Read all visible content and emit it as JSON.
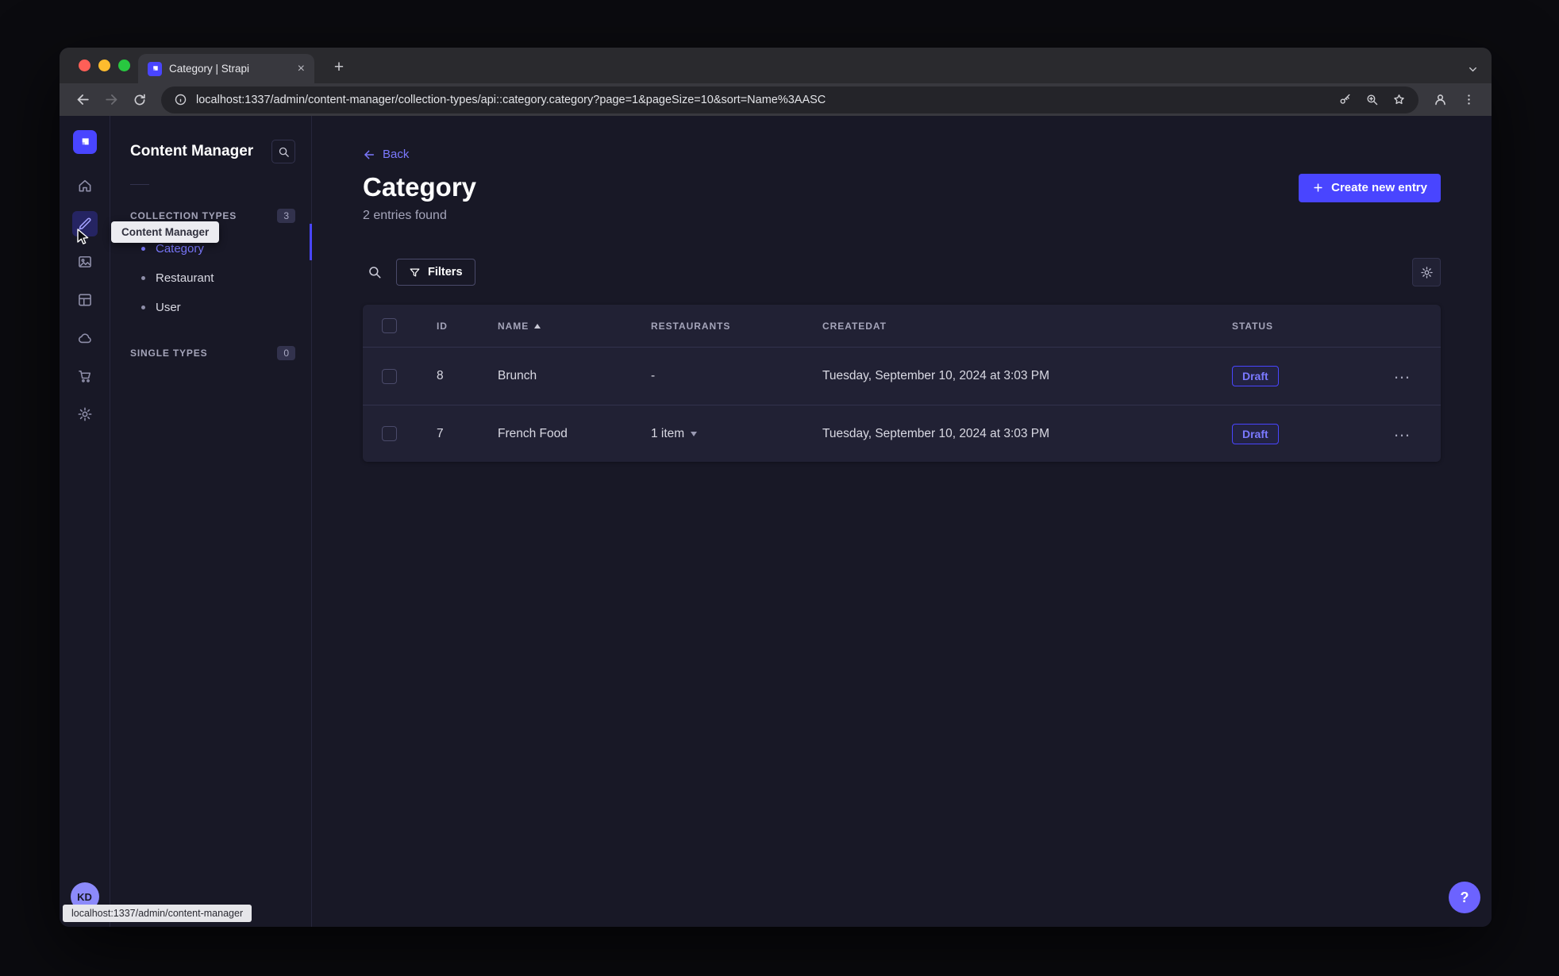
{
  "browser": {
    "tab_title": "Category | Strapi",
    "url": "localhost:1337/admin/content-manager/collection-types/api::category.category?page=1&pageSize=10&sort=Name%3AASC",
    "status_text": "localhost:1337/admin/content-manager"
  },
  "rail": {
    "tooltip": "Content Manager",
    "avatar_initials": "KD"
  },
  "subnav": {
    "title": "Content Manager",
    "sections": [
      {
        "label": "COLLECTION TYPES",
        "badge": "3"
      },
      {
        "label": "SINGLE TYPES",
        "badge": "0"
      }
    ],
    "items": [
      {
        "label": "Category",
        "active": true
      },
      {
        "label": "Restaurant",
        "active": false
      },
      {
        "label": "User",
        "active": false
      }
    ]
  },
  "main": {
    "back_label": "Back",
    "page_title": "Category",
    "entries_found": "2 entries found",
    "create_button_label": "Create new entry",
    "filters_button_label": "Filters",
    "table": {
      "headers": {
        "id": "ID",
        "name": "NAME",
        "restaurants": "RESTAURANTS",
        "created_at": "CREATEDAT",
        "status": "STATUS"
      },
      "rows": [
        {
          "id": "8",
          "name": "Brunch",
          "restaurants": "-",
          "created_at": "Tuesday, September 10, 2024 at 3:03 PM",
          "status": "Draft"
        },
        {
          "id": "7",
          "name": "French Food",
          "restaurants": "1 item",
          "created_at": "Tuesday, September 10, 2024 at 3:03 PM",
          "status": "Draft"
        }
      ]
    },
    "help_label": "?"
  },
  "colors": {
    "accent": "#4945ff",
    "accent_light": "#7b79ff",
    "status_draft": "#7b79ff"
  }
}
